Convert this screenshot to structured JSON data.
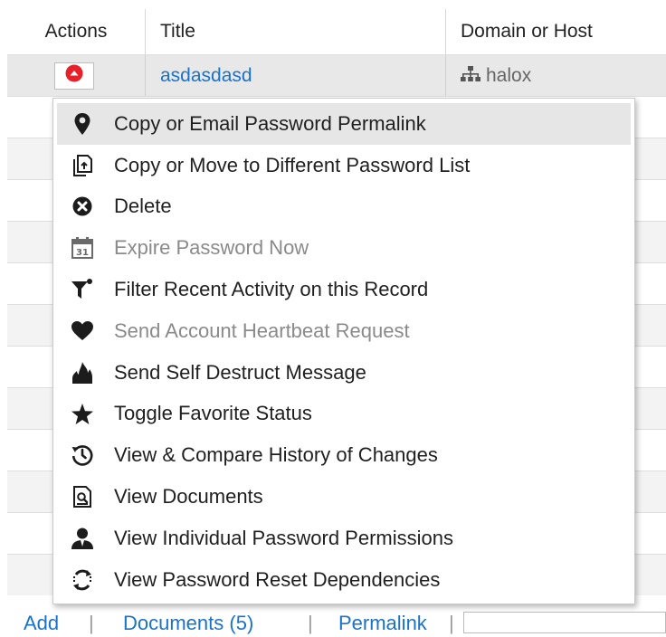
{
  "grid": {
    "columns": {
      "actions": "Actions",
      "title": "Title",
      "domain": "Domain or Host"
    },
    "selected_row": {
      "title": "asdasdasd",
      "domain": "halox"
    }
  },
  "menu": {
    "items": [
      {
        "label": "Copy or Email Password Permalink",
        "icon": "map-marker-icon",
        "disabled": false,
        "hover": true
      },
      {
        "label": "Copy or Move to Different Password List",
        "icon": "copy-icon",
        "disabled": false
      },
      {
        "label": "Delete",
        "icon": "delete-circle-icon",
        "disabled": false
      },
      {
        "label": "Expire Password Now",
        "icon": "calendar-icon",
        "disabled": true
      },
      {
        "label": "Filter Recent Activity on this Record",
        "icon": "filter-icon",
        "disabled": false
      },
      {
        "label": "Send Account Heartbeat Request",
        "icon": "heart-icon",
        "disabled": true
      },
      {
        "label": "Send Self Destruct Message",
        "icon": "fire-icon",
        "disabled": false
      },
      {
        "label": "Toggle Favorite Status",
        "icon": "star-icon",
        "disabled": false
      },
      {
        "label": "View & Compare History of Changes",
        "icon": "history-icon",
        "disabled": false
      },
      {
        "label": "View Documents",
        "icon": "document-icon",
        "disabled": false
      },
      {
        "label": "View Individual Password Permissions",
        "icon": "user-icon",
        "disabled": false
      },
      {
        "label": "View Password Reset Dependencies",
        "icon": "refresh-icon",
        "disabled": false
      }
    ]
  },
  "bottom_bar": {
    "add": "Add",
    "documents": "Documents (5)",
    "permalink": "Permalink"
  },
  "colors": {
    "link": "#1a73c8",
    "actions_button": "#e8202a",
    "hover": "#e6e6e6",
    "disabled_text": "#8a8a8a"
  }
}
